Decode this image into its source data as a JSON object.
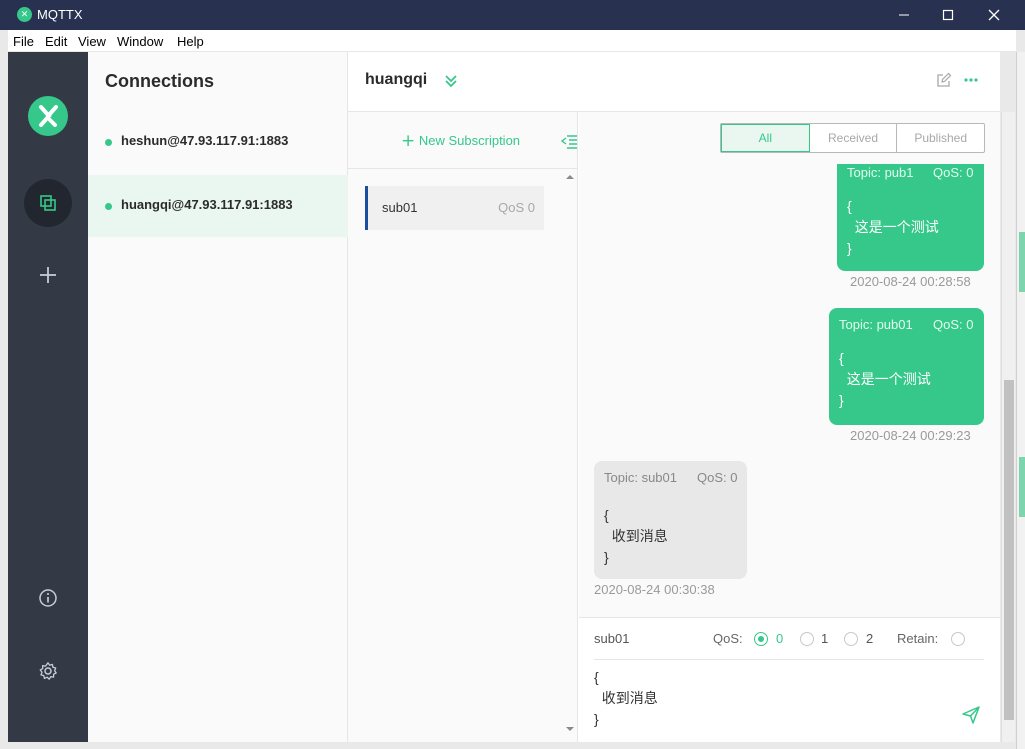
{
  "window": {
    "title": "MQTTX",
    "app_logo_icon": "mqttx-logo-icon"
  },
  "menu": [
    "File",
    "Edit",
    "View",
    "Window",
    "Help"
  ],
  "nav": {
    "items": [
      "connections-icon",
      "add-icon",
      "info-icon",
      "settings-icon"
    ]
  },
  "connections": {
    "header": "Connections",
    "items": [
      {
        "name": "heshun@47.93.117.91:1883",
        "status": "connected"
      },
      {
        "name": "huangqi@47.93.117.91:1883",
        "status": "connected",
        "active": true
      }
    ]
  },
  "main": {
    "connection_name": "huangqi",
    "new_subscription_label": "New Subscription",
    "subscriptions": [
      {
        "topic": "sub01",
        "qos": "QoS 0"
      }
    ],
    "filter_tabs": [
      "All",
      "Received",
      "Published"
    ],
    "active_tab": "All",
    "messages": [
      {
        "direction": "sent",
        "topic": "Topic: pub1",
        "qos": "QoS: 0",
        "body": "{\n  这是一个测试\n}",
        "time": "2020-08-24 00:28:58"
      },
      {
        "direction": "sent",
        "topic": "Topic: pub01",
        "qos": "QoS: 0",
        "body": "{\n  这是一个测试\n}",
        "time": "2020-08-24 00:29:23"
      },
      {
        "direction": "received",
        "topic": "Topic: sub01",
        "qos": "QoS: 0",
        "body": "{\n  收到消息\n}",
        "time": "2020-08-24 00:30:38"
      }
    ],
    "composer": {
      "topic": "sub01",
      "qos_label": "QoS:",
      "qos_options": [
        "0",
        "1",
        "2"
      ],
      "qos_selected": "0",
      "retain_label": "Retain:",
      "retain": false,
      "payload": "{\n  收到消息\n}"
    }
  },
  "colors": {
    "accent": "#35c88a",
    "titlebar": "#283250",
    "nav": "#333a45"
  }
}
